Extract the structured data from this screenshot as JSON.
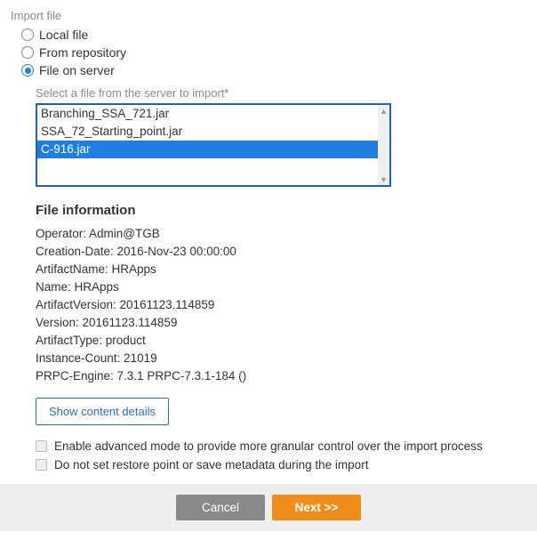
{
  "header": {
    "title": "Import file"
  },
  "source_options": [
    {
      "label": "Local file",
      "selected": false
    },
    {
      "label": "From repository",
      "selected": false
    },
    {
      "label": "File on server",
      "selected": true
    }
  ],
  "server_file": {
    "field_label": "Select a file from the server to import",
    "required_marker": "*",
    "items": [
      {
        "name": "Branching_SSA_721.jar",
        "selected": false
      },
      {
        "name": "SSA_72_Starting_point.jar",
        "selected": false
      },
      {
        "name": "C-916.jar",
        "selected": true
      }
    ]
  },
  "file_info": {
    "header": "File information",
    "lines": [
      "Operator: Admin@TGB",
      "Creation-Date: 2016-Nov-23 00:00:00",
      "ArtifactName: HRApps",
      "Name: HRApps",
      "ArtifactVersion: 20161123.114859",
      "Version: 20161123.114859",
      "ArtifactType: product",
      "Instance-Count: 21019",
      "PRPC-Engine: 7.3.1 PRPC-7.3.1-184 ()"
    ],
    "details_button": "Show content details"
  },
  "options": {
    "advanced_mode": "Enable advanced mode to provide more granular control over the import process",
    "no_restore": "Do not set restore point or save metadata during the import"
  },
  "footer": {
    "cancel": "Cancel",
    "next": "Next  >>"
  }
}
